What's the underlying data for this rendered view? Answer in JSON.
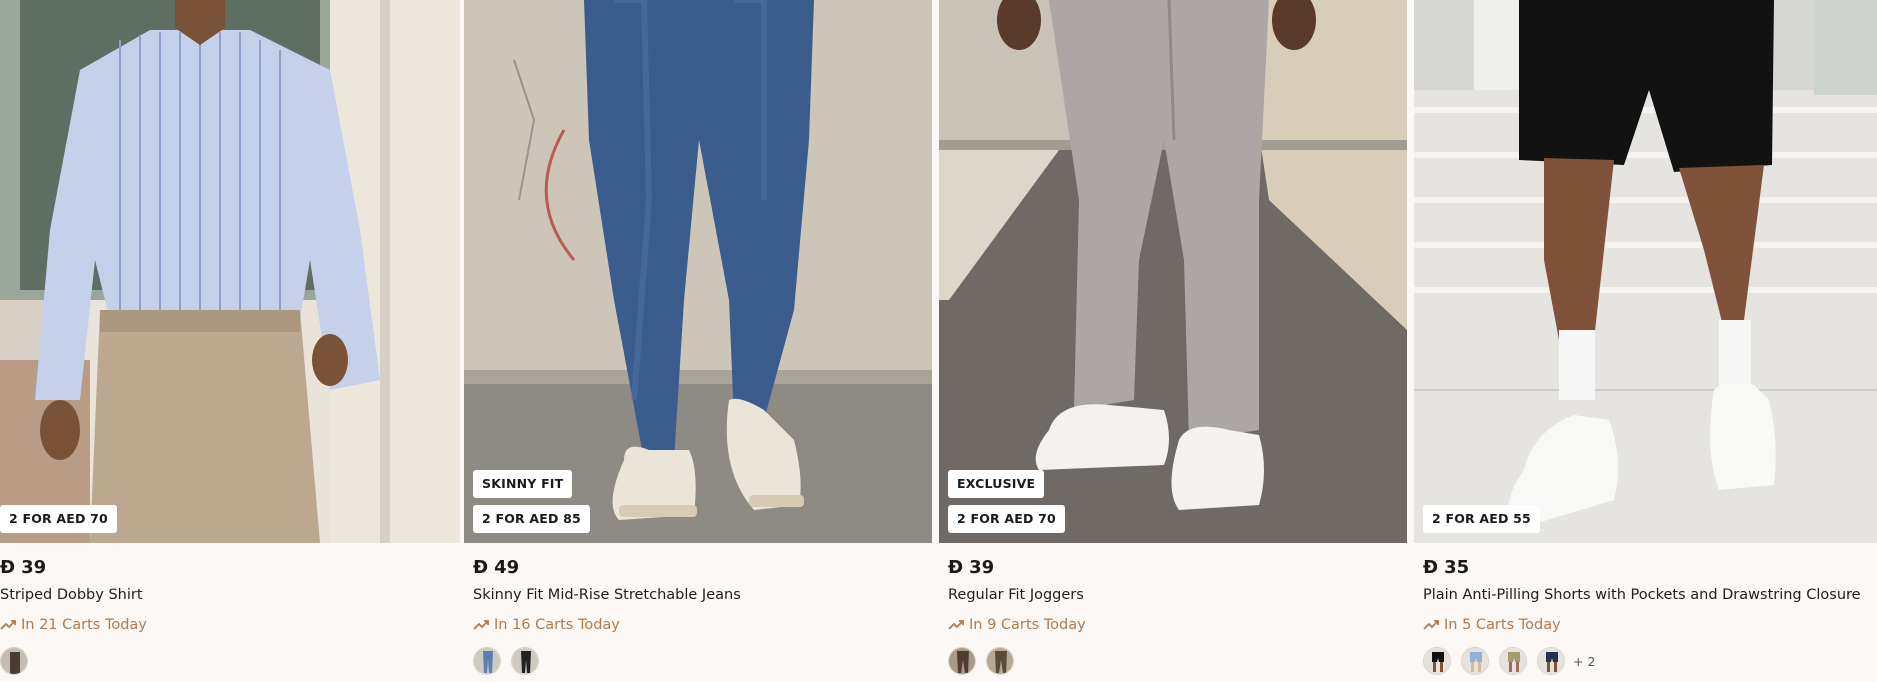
{
  "products": [
    {
      "offer": "2 FOR AED 70",
      "tag": "",
      "currency_symbol": "Đ",
      "price": "39",
      "name": "Striped Dobby Shirt",
      "trend": "In 21 Carts Today",
      "swatches": [
        "shirt-swatch"
      ],
      "more_colors": ""
    },
    {
      "offer": "2 FOR AED 85",
      "tag": "SKINNY FIT",
      "currency_symbol": "Đ",
      "price": "49",
      "name": "Skinny Fit Mid-Rise Stretchable Jeans",
      "trend": "In 16 Carts Today",
      "swatches": [
        "blue-jeans-swatch",
        "black-jeans-swatch"
      ],
      "more_colors": ""
    },
    {
      "offer": "2 FOR AED 70",
      "tag": "EXCLUSIVE",
      "currency_symbol": "Đ",
      "price": "39",
      "name": "Regular Fit Joggers",
      "trend": "In 9 Carts Today",
      "swatches": [
        "brown-joggers-swatch",
        "brown-joggers-swatch-2"
      ],
      "more_colors": ""
    },
    {
      "offer": "2 FOR AED 55",
      "tag": "",
      "currency_symbol": "Đ",
      "price": "35",
      "name": "Plain Anti-Pilling Shorts with Pockets and Drawstring Closure",
      "trend": "In 5 Carts Today",
      "swatches": [
        "black-shorts-swatch",
        "blue-shorts-swatch",
        "khaki-shorts-swatch",
        "navy-shorts-swatch"
      ],
      "more_colors": "+ 2"
    }
  ],
  "colors": {
    "background": "#fbf8f5",
    "trend_accent": "#b07a4f",
    "badge_bg": "#ffffff"
  },
  "icons": {
    "trend": "trending-up-icon"
  }
}
